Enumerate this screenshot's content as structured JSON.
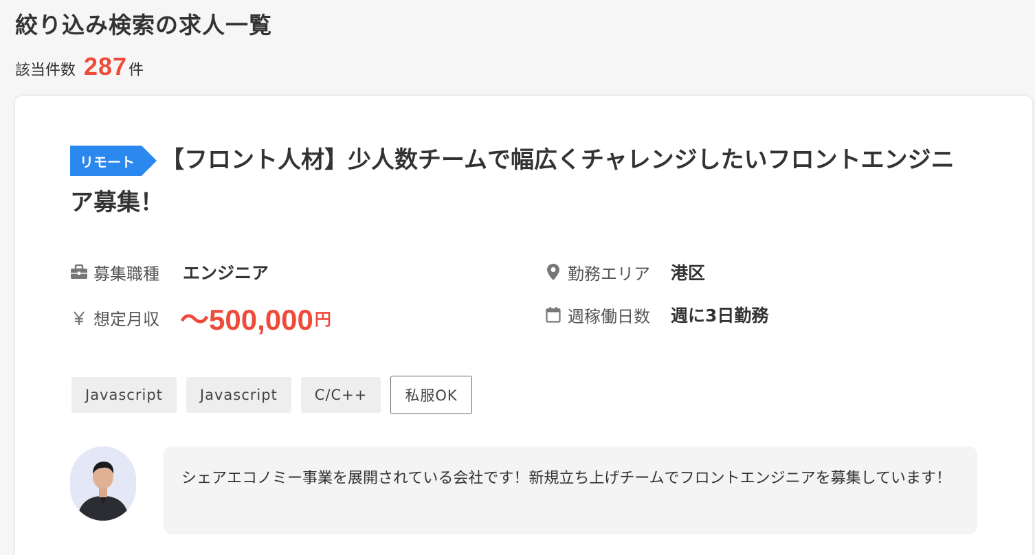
{
  "page": {
    "title": "絞り込み検索の求人一覧",
    "result_label": "該当件数",
    "result_count": "287",
    "result_unit": "件"
  },
  "job": {
    "badge": "リモート",
    "title": "【フロント人材】少人数チームで幅広くチャレンジしたいフロントエンジニア募集！",
    "job_type": {
      "label": "募集職種",
      "value": "エンジニア",
      "icon": "briefcase-icon"
    },
    "salary": {
      "label": "想定月収",
      "value": "〜500,000",
      "unit": "円",
      "icon": "yen-icon"
    },
    "area": {
      "label": "勤務エリア",
      "value": "港区",
      "icon": "map-pin-icon"
    },
    "workdays": {
      "label": "週稼働日数",
      "value": "週に3日勤務",
      "icon": "calendar-icon"
    },
    "tags": [
      {
        "label": "Javascript",
        "style": "filled"
      },
      {
        "label": "Javascript",
        "style": "filled"
      },
      {
        "label": "C/C++",
        "style": "filled"
      },
      {
        "label": "私服OK",
        "style": "outlined"
      }
    ],
    "message": "シェアエコノミー事業を展開されている会社です！新規立ち上げチームでフロントエンジニアを募集しています！"
  },
  "colors": {
    "accent_red": "#ef4b3b",
    "badge_blue": "#2b88ee",
    "text": "#333333",
    "background": "#f6f6f6"
  }
}
